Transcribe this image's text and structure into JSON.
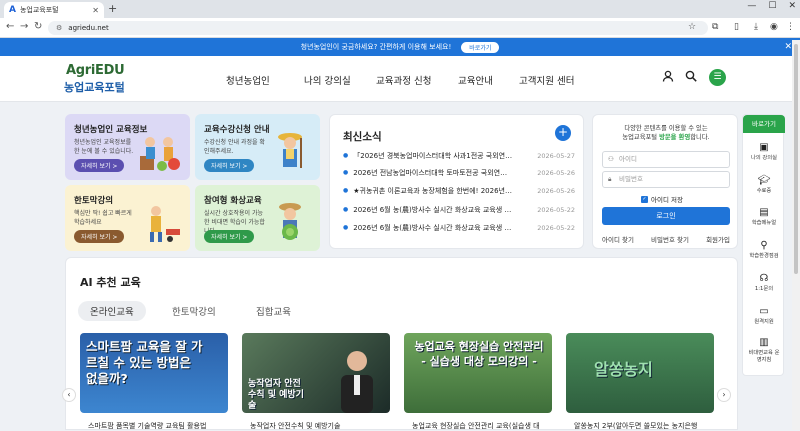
{
  "browser": {
    "tab_title": "농업교육포털",
    "tab_icon": "A",
    "new_tab": "+",
    "url": "agriedu.net"
  },
  "banner": {
    "text": "청년농업인이 궁금하세요? 간편하게 이용해 보세요!",
    "button": "바로가기"
  },
  "header": {
    "logo_top": "AgriEDU",
    "logo_bottom": "농업교육포털",
    "nav": [
      "청년농업인",
      "나의 강의실",
      "교육과정 신청",
      "교육안내",
      "고객지원 센터"
    ]
  },
  "cards": [
    {
      "title": "청년농업인 교육정보",
      "desc": "청년농업인 교육정보를 한 눈에 볼 수 있습니다.",
      "button": "자세히 보기 >",
      "bg": "#dcd9f5",
      "btn_color": "#5b4fb0"
    },
    {
      "title": "교육수강신청 안내",
      "desc": "수강신청 안내 과정을 확인해주세요.",
      "button": "자세히 보기 >",
      "bg": "#d6ecf7",
      "btn_color": "#2f86c3"
    },
    {
      "title": "한토막강의",
      "desc": "핵심만 딱! 쉽고 빠르게 학습하세요",
      "button": "자세히 보기 >",
      "bg": "#fbf2d2",
      "btn_color": "#8a5a2f"
    },
    {
      "title": "참여형 화상교육",
      "desc": "실시간 상호작용이 가능한 비대면 학습이 가능합니다.",
      "button": "자세히 보기 >",
      "bg": "#def2d6",
      "btn_color": "#2f9a4a"
    }
  ],
  "news": {
    "title": "최신소식",
    "items": [
      {
        "text": "「2026년 경북농업마이스터대학 사과1전공 국외연…",
        "date": "2026-05-27"
      },
      {
        "text": "2026년 전남농업마이스터대학 토마토전공 국외연…",
        "date": "2026-05-26"
      },
      {
        "text": "★귀농귀촌 이론교육과 농장체험을 한번에! 2026년…",
        "date": "2026-05-26"
      },
      {
        "text": "2026년 6월 농(農)방사수 실시간 화상교육 교육생 …",
        "date": "2026-05-22"
      },
      {
        "text": "2026년 6월 농(農)방사수 실시간 화상교육 교육생 …",
        "date": "2026-05-22"
      }
    ]
  },
  "login": {
    "intro1": "다양한 콘텐츠를 이용할 수 있는",
    "intro2a": "농업교육포털 ",
    "intro2b": "방문을 환영",
    "intro2c": "합니다.",
    "id_placeholder": "아이디",
    "pw_placeholder": "비밀번호",
    "save_id": "아이디 저장",
    "login_button": "로그인",
    "links": [
      "아이디 찾기",
      "비밀번호 찾기",
      "회원가입"
    ]
  },
  "sidebar": {
    "title": "바로가기",
    "items": [
      {
        "label": "나의 강의실",
        "icon": "monitor-play-icon"
      },
      {
        "label": "수료증",
        "icon": "graduation-cap-icon"
      },
      {
        "label": "학습메뉴얼",
        "icon": "manual-icon"
      },
      {
        "label": "학습환경점검",
        "icon": "magnifier-icon"
      },
      {
        "label": "1:1문의",
        "icon": "headset-icon"
      },
      {
        "label": "원격지원",
        "icon": "laptop-icon"
      },
      {
        "label": "비대면교육 운영지침",
        "icon": "document-icon"
      }
    ]
  },
  "ai": {
    "title": "AI 추천 교육",
    "tabs": [
      "온라인교육",
      "한토막강의",
      "집합교육"
    ],
    "videos": [
      {
        "thumb_text": "스마트팜 교육을 잘 가르칠 수 있는 방법은 없을까?",
        "caption": "스마트팜 품목별 기술역량 교육팀 활용법"
      },
      {
        "thumb_text": "농작업자 안전수칙 및 예방기술",
        "caption": "농작업자 안전수칙 및 예방기술"
      },
      {
        "thumb_text": "농업교육 현장실습 안전관리 - 실습생 대상 모의강의 -",
        "caption": "농업교육 현장실습 안전관리 교육(실습생 대"
      },
      {
        "thumb_text": "알쏭농지",
        "caption": "알쏭농지 2부(알아두면 쏠모있는 농지은행"
      }
    ]
  }
}
